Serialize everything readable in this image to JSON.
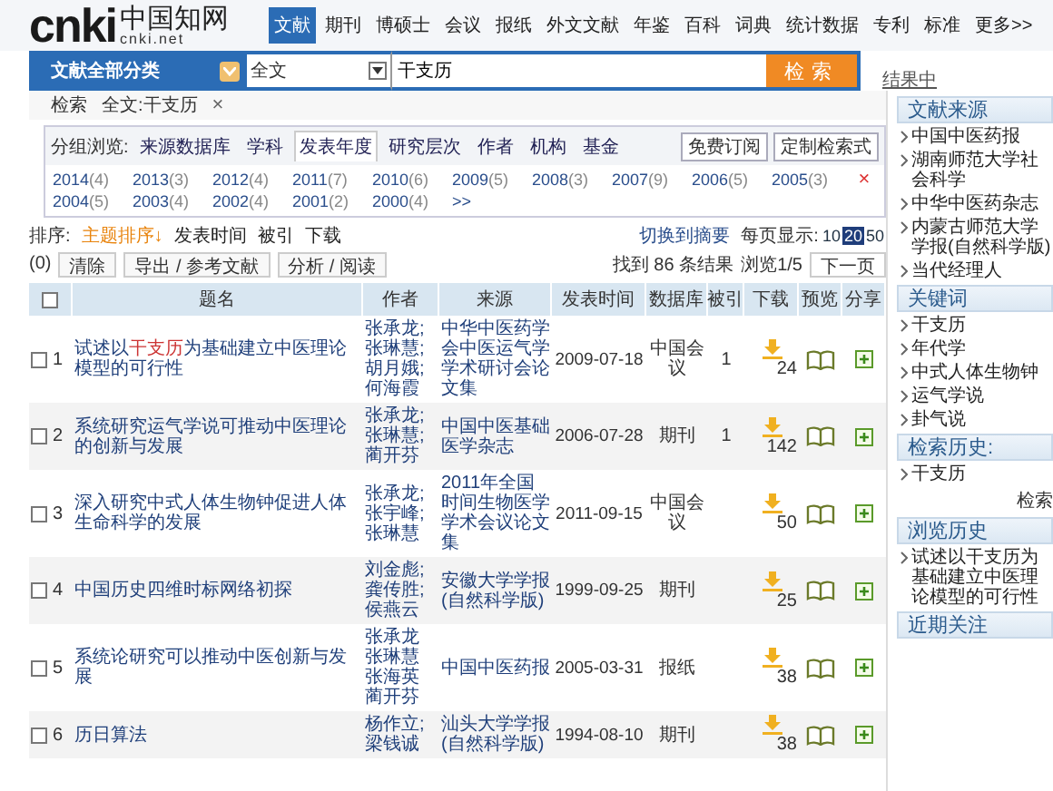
{
  "logo": {
    "mark": "cnki",
    "name": "中国知网",
    "domain": "cnki.net"
  },
  "nav_tabs": [
    {
      "label": "文献",
      "selected": true
    },
    {
      "label": "期刊",
      "selected": false
    },
    {
      "label": "博硕士",
      "selected": false
    },
    {
      "label": "会议",
      "selected": false
    },
    {
      "label": "报纸",
      "selected": false
    },
    {
      "label": "外文文献",
      "selected": false
    },
    {
      "label": "年鉴",
      "selected": false
    },
    {
      "label": "百科",
      "selected": false
    },
    {
      "label": "词典",
      "selected": false
    },
    {
      "label": "统计数据",
      "selected": false
    },
    {
      "label": "专利",
      "selected": false
    },
    {
      "label": "标准",
      "selected": false
    },
    {
      "label": "更多>>",
      "selected": false
    }
  ],
  "search": {
    "category": "文献全部分类",
    "field": "全文",
    "value": "干支历",
    "button": "检索",
    "side_link": "结果中"
  },
  "crumbs": {
    "label": "检索",
    "query": "全文:干支历",
    "remove": "×"
  },
  "group_browse": {
    "label": "分组浏览:",
    "tabs": [
      {
        "label": "来源数据库",
        "selected": false
      },
      {
        "label": "学科",
        "selected": false
      },
      {
        "label": "发表年度",
        "selected": true
      },
      {
        "label": "研究层次",
        "selected": false
      },
      {
        "label": "作者",
        "selected": false
      },
      {
        "label": "机构",
        "selected": false
      },
      {
        "label": "基金",
        "selected": false
      }
    ],
    "buttons": [
      "免费订阅",
      "定制检索式"
    ],
    "years": [
      {
        "year": "2014",
        "count": "(4)"
      },
      {
        "year": "2013",
        "count": "(3)"
      },
      {
        "year": "2012",
        "count": "(4)"
      },
      {
        "year": "2011",
        "count": "(7)"
      },
      {
        "year": "2010",
        "count": "(6)"
      },
      {
        "year": "2009",
        "count": "(5)"
      },
      {
        "year": "2008",
        "count": "(3)"
      },
      {
        "year": "2007",
        "count": "(9)"
      },
      {
        "year": "2006",
        "count": "(5)"
      },
      {
        "year": "2005",
        "count": "(3)"
      },
      {
        "year": "2004",
        "count": "(5)"
      },
      {
        "year": "2003",
        "count": "(4)"
      },
      {
        "year": "2002",
        "count": "(4)"
      },
      {
        "year": "2001",
        "count": "(2)"
      },
      {
        "year": "2000",
        "count": "(4)"
      }
    ],
    "more": ">>",
    "close": "×"
  },
  "sort": {
    "label": "排序:",
    "options": [
      {
        "label": "主题排序↓",
        "selected": true
      },
      {
        "label": "发表时间",
        "selected": false
      },
      {
        "label": "被引",
        "selected": false
      },
      {
        "label": "下载",
        "selected": false
      }
    ],
    "switch_view": "切换到摘要",
    "per_page_label": "每页显示:",
    "per_page": [
      {
        "label": "10",
        "selected": false
      },
      {
        "label": "20",
        "selected": true
      },
      {
        "label": "50",
        "selected": false
      }
    ]
  },
  "toolbar": {
    "count": "(0)",
    "buttons": [
      "清除",
      "导出 / 参考文献",
      "分析 / 阅读"
    ],
    "results": "找到 86 条结果",
    "page": "浏览1/5",
    "next": "下一页"
  },
  "table": {
    "select_all": {
      "checked": false
    },
    "columns": [
      "题名",
      "作者",
      "来源",
      "发表时间",
      "数据库",
      "被引",
      "下载",
      "预览",
      "分享"
    ],
    "rows": [
      {
        "index": "1",
        "checked": false,
        "title_parts": [
          {
            "text": "试述以",
            "highlight": false
          },
          {
            "text": "干支历",
            "highlight": true
          },
          {
            "text": "为基础建立中医理论模型的可行性",
            "highlight": false
          }
        ],
        "authors": [
          "张承龙;",
          "张琳慧;",
          "胡月娥;",
          "何海霞"
        ],
        "source": "中华中医药学会中医运气学学术研讨会论文集",
        "date": "2009-07-18",
        "database": "中国会议",
        "citations": "1",
        "downloads": "24"
      },
      {
        "index": "2",
        "checked": false,
        "title_parts": [
          {
            "text": "系统研究运气学说可推动中医理论的创新与发展",
            "highlight": false
          }
        ],
        "authors": [
          "张承龙;",
          "张琳慧;",
          "蔺开芬"
        ],
        "source": "中国中医基础医学杂志",
        "date": "2006-07-28",
        "database": "期刊",
        "citations": "1",
        "downloads": "142"
      },
      {
        "index": "3",
        "checked": false,
        "title_parts": [
          {
            "text": "深入研究中式人体生物钟促进人体生命科学的发展",
            "highlight": false
          }
        ],
        "authors": [
          "张承龙;",
          "张宇峰;",
          "张琳慧"
        ],
        "source": "2011年全国时间生物医学学术会议论文集",
        "date": "2011-09-15",
        "database": "中国会议",
        "downloads": "50"
      },
      {
        "index": "4",
        "checked": false,
        "title_parts": [
          {
            "text": "中国历史四维时标网络初探",
            "highlight": false
          }
        ],
        "authors": [
          "刘金彪;",
          "龚传胜;",
          "侯燕云"
        ],
        "source": "安徽大学学报(自然科学版)",
        "date": "1999-09-25",
        "database": "期刊",
        "downloads": "25"
      },
      {
        "index": "5",
        "checked": false,
        "title_parts": [
          {
            "text": "系统论研究可以推动中医创新与发展",
            "highlight": false
          }
        ],
        "authors": [
          "张承龙",
          "张琳慧",
          "张海英",
          "蔺开芬"
        ],
        "source": "中国中医药报",
        "date": "2005-03-31",
        "database": "报纸",
        "downloads": "38"
      },
      {
        "index": "6",
        "checked": false,
        "title_parts": [
          {
            "text": "历日算法",
            "highlight": false
          }
        ],
        "authors": [
          "杨作立;",
          "梁钱诚"
        ],
        "source": "汕头大学学报(自然科学版)",
        "date": "1994-08-10",
        "database": "期刊",
        "downloads": "38"
      }
    ]
  },
  "sidebar": [
    {
      "title": "文献来源",
      "items": [
        "中国中医药报",
        "湖南师范大学社会科学",
        "中华中医药杂志",
        "内蒙古师范大学学报(自然科学版)",
        "当代经理人"
      ]
    },
    {
      "title": "关键词",
      "items": [
        "干支历",
        "年代学",
        "中式人体生物钟",
        "运气学说",
        "卦气说"
      ]
    },
    {
      "title": "检索历史:",
      "items": [
        "干支历"
      ],
      "action": "检索"
    },
    {
      "title": "浏览历史",
      "items": [
        "试述以干支历为基础建立中医理论模型的可行性"
      ]
    },
    {
      "title": "近期关注"
    }
  ]
}
